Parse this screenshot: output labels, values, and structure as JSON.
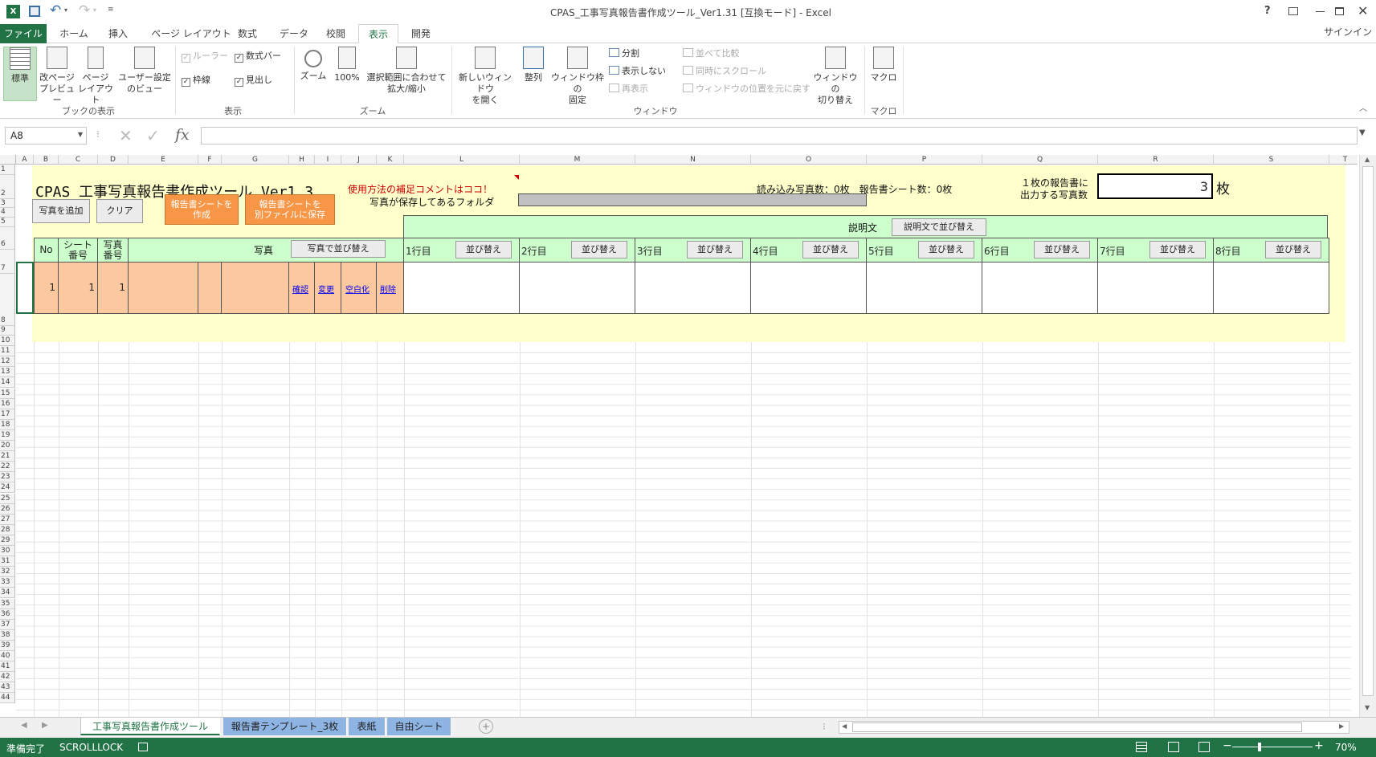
{
  "app": {
    "title": "CPAS_工事写真報告書作成ツール_Ver1.31  [互換モード] - Excel",
    "help_label": "?",
    "signin_label": "サインイン"
  },
  "ribbon_tabs": [
    {
      "label": "ファイル",
      "state": "file"
    },
    {
      "label": "ホーム",
      "state": ""
    },
    {
      "label": "挿入",
      "state": ""
    },
    {
      "label": "ページ レイアウト",
      "state": ""
    },
    {
      "label": "数式",
      "state": ""
    },
    {
      "label": "データ",
      "state": ""
    },
    {
      "label": "校閲",
      "state": ""
    },
    {
      "label": "表示",
      "state": "active"
    },
    {
      "label": "開発",
      "state": ""
    }
  ],
  "ribbon": {
    "views": {
      "normal": "標準",
      "pagebreak": [
        "改ページ",
        "プレビュー"
      ],
      "pagelayout": [
        "ページ",
        "レイアウト"
      ],
      "custom": [
        "ユーザー設定",
        "のビュー"
      ],
      "group": "ブックの表示"
    },
    "show": {
      "ruler": "ルーラー",
      "formula_bar": "数式バー",
      "gridlines": "枠線",
      "headings": "見出し",
      "group": "表示"
    },
    "zoom": {
      "zoom": "ズーム",
      "hundred": "100%",
      "selection": [
        "選択範囲に合わせて",
        "拡大/縮小"
      ],
      "group": "ズーム"
    },
    "window": {
      "new_window": [
        "新しいウィンドウ",
        "を開く"
      ],
      "arrange": "整列",
      "freeze": [
        "ウィンドウ枠の",
        "固定"
      ],
      "split": "分割",
      "hide": "表示しない",
      "unhide": "再表示",
      "side_by_side": "並べて比較",
      "sync_scroll": "同時にスクロール",
      "reset_pos": "ウィンドウの位置を元に戻す",
      "switch": [
        "ウィンドウの",
        "切り替え"
      ],
      "group": "ウィンドウ"
    },
    "macro": {
      "macros": "マクロ",
      "group": "マクロ"
    }
  },
  "formula_bar": {
    "name_box": "A8",
    "fx": "fx",
    "content": ""
  },
  "columns": [
    "A",
    "B",
    "C",
    "D",
    "E",
    "F",
    "G",
    "H",
    "I",
    "J",
    "K",
    "L",
    "M",
    "N",
    "O",
    "P",
    "Q",
    "R",
    "S",
    "T"
  ],
  "rows": [
    "1",
    "2",
    "3",
    "4",
    "5",
    "6",
    "7",
    "8",
    "9",
    "10",
    "11",
    "12",
    "13",
    "14",
    "15",
    "16",
    "17",
    "18",
    "19",
    "20",
    "21",
    "22",
    "23",
    "24",
    "25",
    "26",
    "27",
    "28",
    "29",
    "30",
    "31",
    "32",
    "33",
    "34",
    "35",
    "36",
    "37",
    "38",
    "39",
    "40",
    "41",
    "42",
    "43",
    "44"
  ],
  "sheet": {
    "title": "CPAS 工事写真報告書作成ツール Ver1.3",
    "hint": "使用方法の補足コメントはココ！",
    "stats": "読み込み写真数：0枚　報告書シート数：0枚",
    "per_report_label": [
      "１枚の報告書に",
      "出力する写真数"
    ],
    "per_report_value": "3",
    "per_report_unit": "枚",
    "folder_label": "写真が保存してあるフォルダ",
    "buttons": {
      "add_photo": "写真を追加",
      "clear": "クリア",
      "create_report": [
        "報告書シートを",
        "作成"
      ],
      "save_report": [
        "報告書シートを",
        "別ファイルに保存"
      ],
      "sort_desc": "説明文で並び替え",
      "sort_photo": "写真で並び替え"
    },
    "desc_header": "説明文",
    "table_headers": {
      "no": "No",
      "sheet_no": [
        "シート",
        "番号"
      ],
      "photo_no": [
        "写真",
        "番号"
      ],
      "photo": "写真"
    },
    "line_headers": [
      {
        "label": "1行目",
        "sort": "並び替え"
      },
      {
        "label": "2行目",
        "sort": "並び替え"
      },
      {
        "label": "3行目",
        "sort": "並び替え"
      },
      {
        "label": "4行目",
        "sort": "並び替え"
      },
      {
        "label": "5行目",
        "sort": "並び替え"
      },
      {
        "label": "6行目",
        "sort": "並び替え"
      },
      {
        "label": "7行目",
        "sort": "並び替え"
      },
      {
        "label": "8行目",
        "sort": "並び替え"
      }
    ],
    "row": {
      "no": "1",
      "sheet_no": "1",
      "photo_no": "1",
      "links": [
        "確認",
        "変更",
        "空白化",
        "削除"
      ]
    }
  },
  "sheet_tabs": [
    {
      "label": "工事写真報告書作成ツール",
      "active": true
    },
    {
      "label": "報告書テンプレート_3枚",
      "active": false
    },
    {
      "label": "表紙",
      "active": false
    },
    {
      "label": "自由シート",
      "active": false
    }
  ],
  "status": {
    "ready": "準備完了",
    "scroll_lock": "SCROLLLOCK",
    "zoom": "70%"
  },
  "colors": {
    "excel_green": "#217346",
    "cream": "#ffffcc",
    "light_green": "#ccffcc",
    "peach": "#fbc8a0",
    "orange": "#f79646",
    "sheet_tab_blue": "#8eb4e3"
  }
}
